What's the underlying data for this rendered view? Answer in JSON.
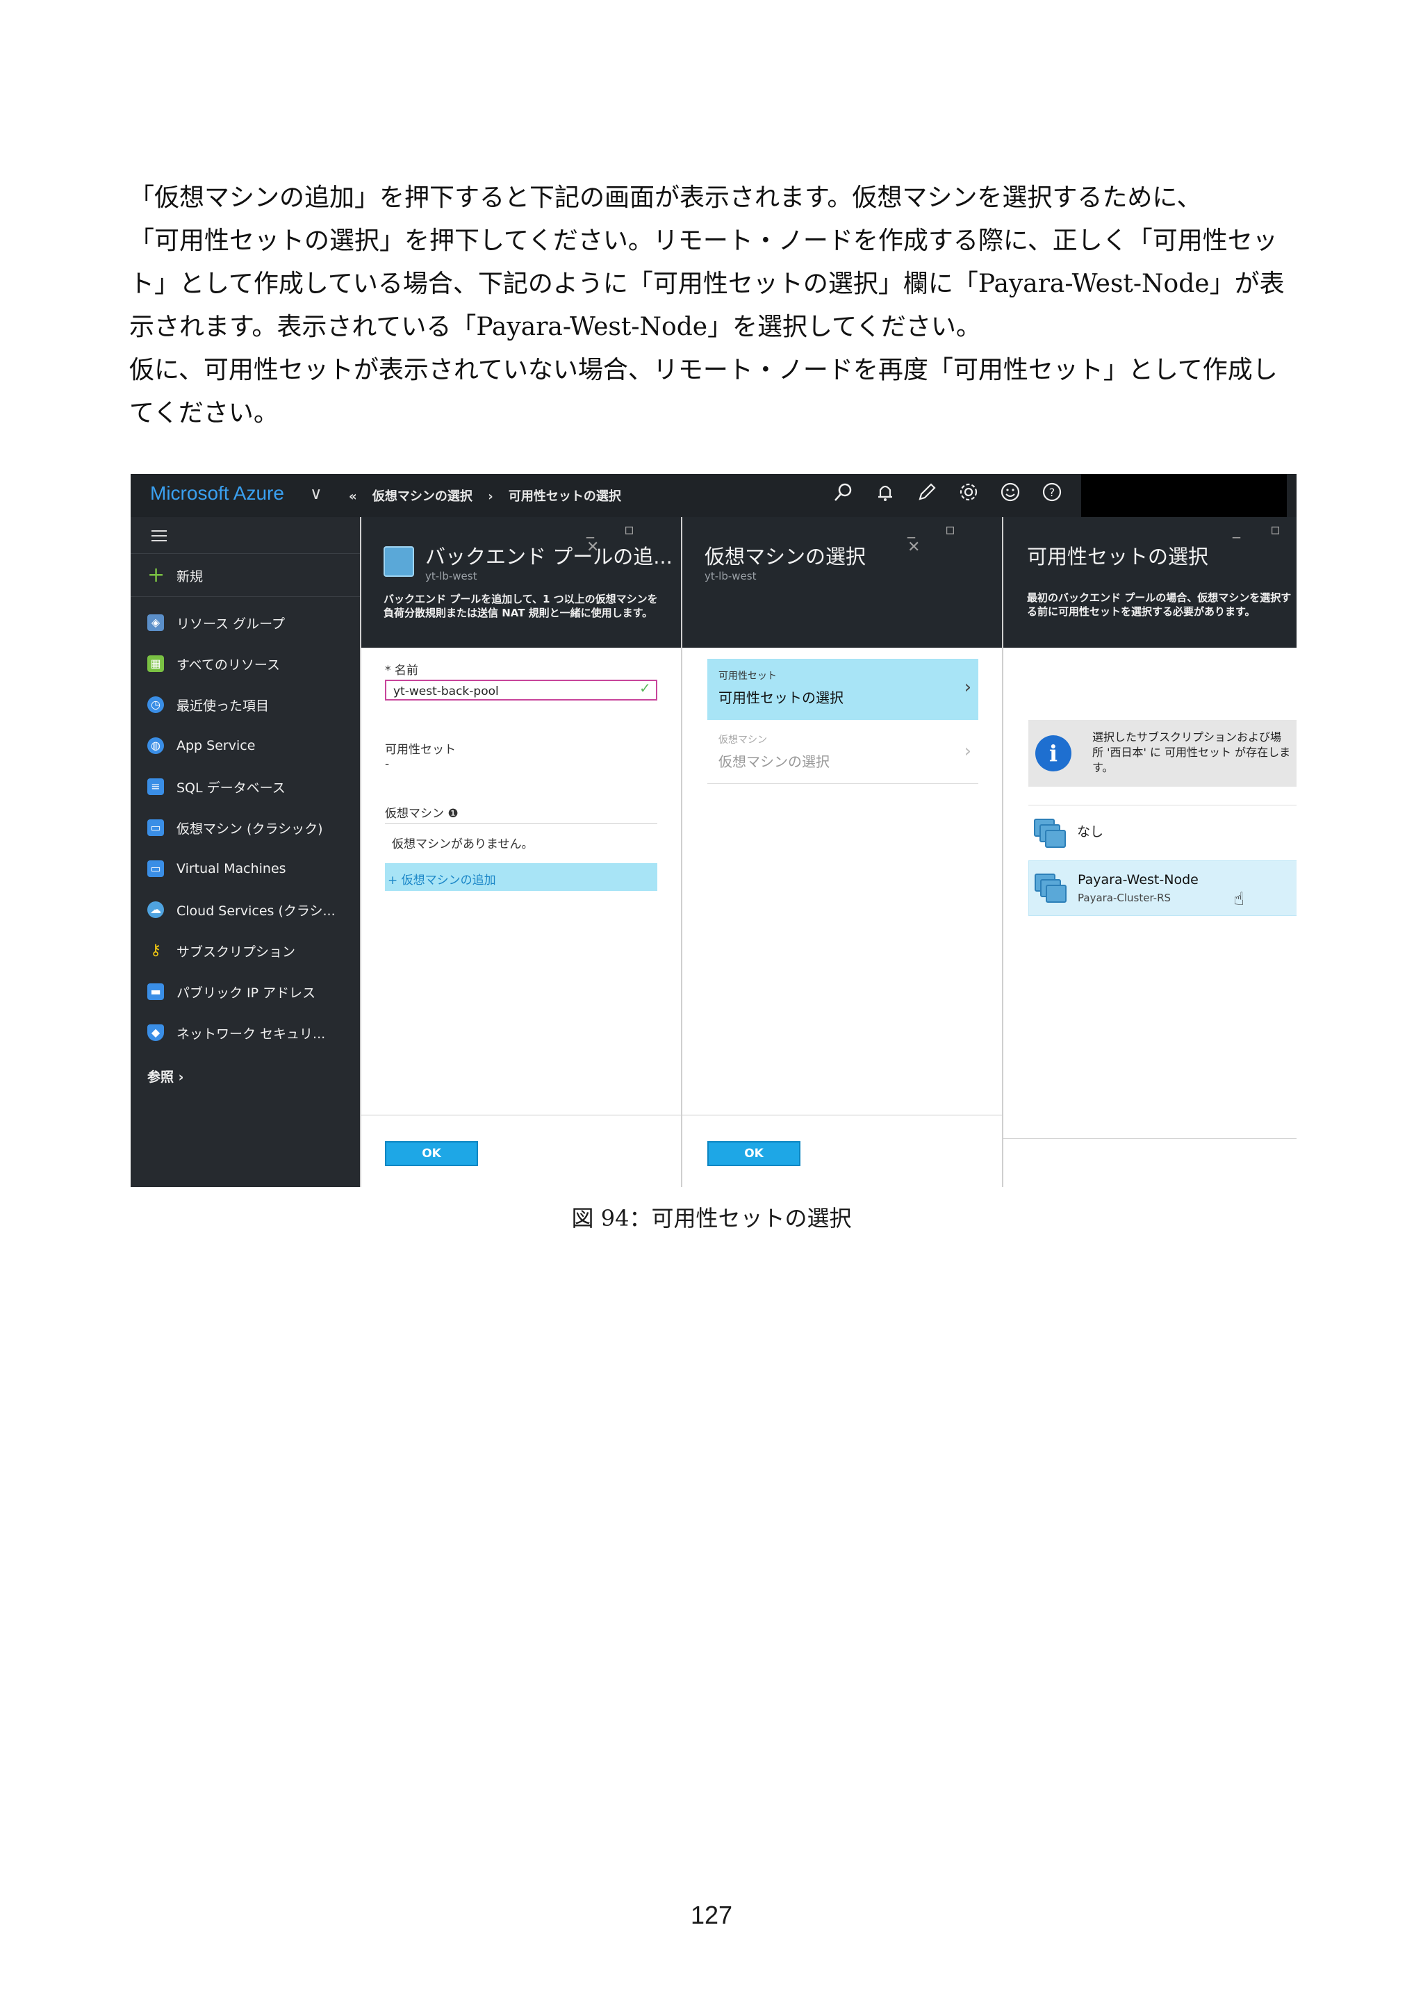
{
  "paragraph": [
    "「仮想マシンの追加」を押下すると下記の画面が表示されます。仮想マシンを選択するために、",
    "「可用性セットの選択」を押下してください。リモート・ノードを作成する際に、正しく「可用性セッ",
    "ト」として作成している場合、下記のように「可用性セットの選択」欄に「Payara-West-Node」が表",
    "示されます。表示されている「Payara-West-Node」を選択してください。",
    "仮に、可用性セットが表示されていない場合、リモート・ノードを再度「可用性セット」として作成し",
    "てください。"
  ],
  "topbar": {
    "brand": "Microsoft Azure",
    "chevron": "∨",
    "back": "«",
    "crumb1": "仮想マシンの選択",
    "sep": "›",
    "crumb2": "可用性セットの選択"
  },
  "sidebar": {
    "new": "新規",
    "items": [
      "リソース グループ",
      "すべてのリソース",
      "最近使った項目",
      "App Service",
      "SQL データベース",
      "仮想マシン (クラシック)",
      "Virtual Machines",
      "Cloud Services (クラシ...",
      "サブスクリプション",
      "パブリック IP アドレス",
      "ネットワーク セキュリ..."
    ],
    "more": "参照 ›"
  },
  "blade1": {
    "title": "バックエンド プールの追...",
    "sub": "yt-lb-west",
    "desc": "バックエンド プールを追加して、1 つ以上の仮想マシンを負荷分散規則または送信 NAT 規則と一緒に使用します。",
    "name_label": "* 名前",
    "name_value": "yt-west-back-pool",
    "availset_label": "可用性セット",
    "availset_value": "-",
    "vm_label": "仮想マシン ❶",
    "vm_empty": "仮想マシンがありません。",
    "vm_add": "+ 仮想マシンの追加",
    "ok": "OK"
  },
  "blade2": {
    "title": "仮想マシンの選択",
    "sub": "yt-lb-west",
    "row1_small": "可用性セット",
    "row1_main": "可用性セットの選択",
    "row2_small": "仮想マシン",
    "row2_main": "仮想マシンの選択",
    "ok": "OK"
  },
  "blade3": {
    "title": "可用性セットの選択",
    "desc": "最初のバックエンド プールの場合、仮想マシンを選択する前に可用性セットを選択する必要があります。",
    "info": "選択したサブスクリプションおよび場所 '西日本' に 可用性セット が存在します。",
    "none": "なし",
    "item_name": "Payara-West-Node",
    "item_sub": "Payara-Cluster-RS"
  },
  "caption": "図 94：可用性セットの選択",
  "page_number": "127",
  "colors": {
    "accent": "#1ea7e6",
    "highlight": "#a8e4f6",
    "header": "#23282d",
    "sidebar": "#262a2f"
  },
  "icons": [
    "search-icon",
    "bell-icon",
    "pencil-icon",
    "gear-icon",
    "smiley-icon",
    "help-icon",
    "info-icon"
  ]
}
